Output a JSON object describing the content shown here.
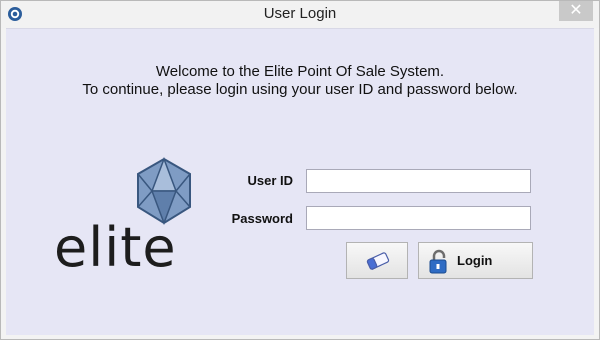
{
  "window": {
    "title": "User Login",
    "close_glyph": "✕"
  },
  "welcome": {
    "line1": "Welcome to the Elite Point Of Sale System.",
    "line2": "To continue, please login using your user ID and password below."
  },
  "logo": {
    "text": "elite"
  },
  "form": {
    "user_id_label": "User ID",
    "user_id_value": "",
    "password_label": "Password",
    "password_value": ""
  },
  "buttons": {
    "clear_icon": "eraser-icon",
    "login_label": "Login",
    "login_icon": "padlock-icon"
  },
  "colors": {
    "client_bg": "#e6e6f5",
    "titlebar_bg": "#f2f2f2",
    "logo_blue": "#6f8fb8"
  }
}
